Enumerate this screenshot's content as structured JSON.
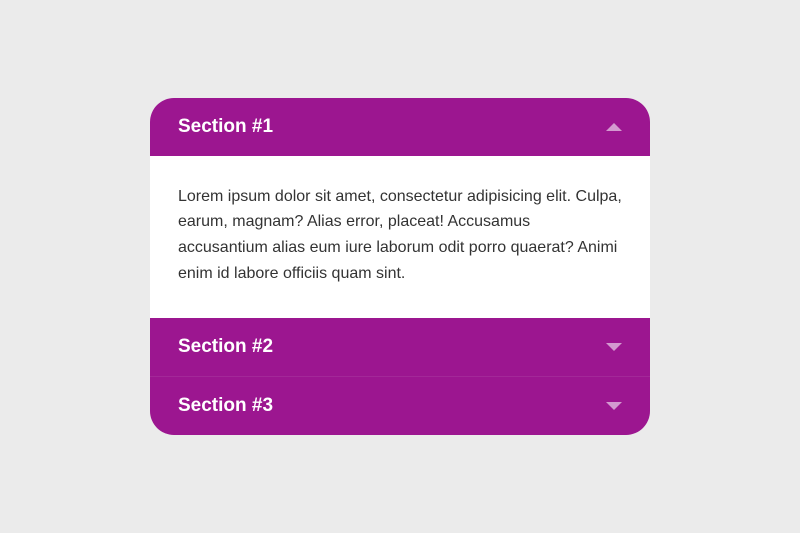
{
  "accordion": {
    "sections": [
      {
        "title": "Section #1",
        "expanded": true,
        "content": "Lorem ipsum dolor sit amet, consectetur adipisicing elit. Culpa, earum, magnam? Alias error, placeat! Accusamus accusantium alias eum iure laborum odit porro quaerat? Animi enim id labore officiis quam sint."
      },
      {
        "title": "Section #2",
        "expanded": false
      },
      {
        "title": "Section #3",
        "expanded": false
      }
    ]
  },
  "colors": {
    "accent": "#9c1690",
    "background": "#ebebeb",
    "contentBg": "#ffffff",
    "iconTint": "#d39ad0"
  }
}
